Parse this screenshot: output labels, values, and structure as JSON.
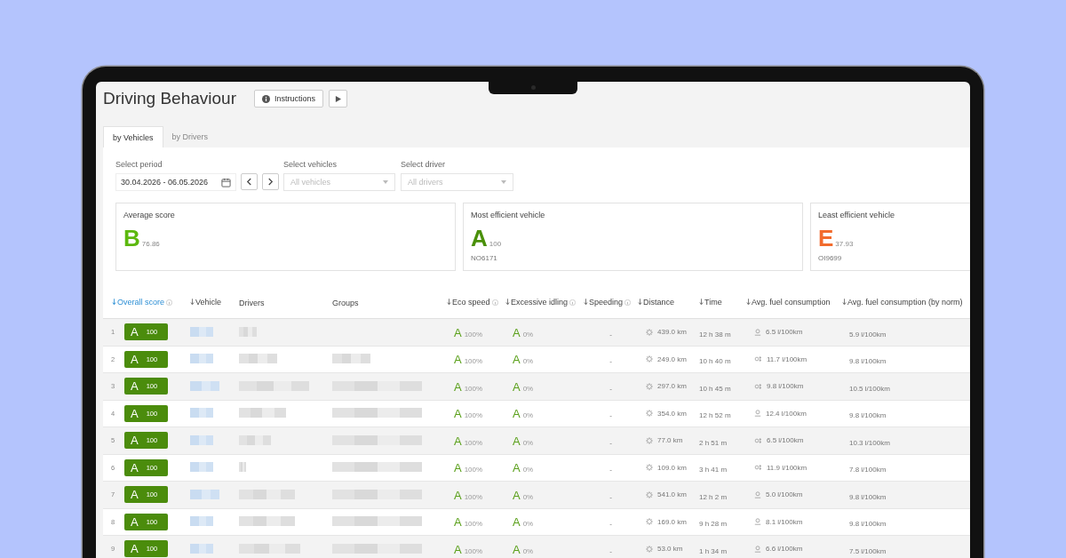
{
  "window": {
    "title": "Driving Behaviour"
  },
  "header_buttons": [
    {
      "kind": "info",
      "label": "Instructions"
    },
    {
      "kind": "play"
    }
  ],
  "tabs": [
    {
      "label": "by Vehicles",
      "selected": true
    },
    {
      "label": "by Drivers",
      "selected": false
    }
  ],
  "filters": {
    "period": {
      "label": "Select period",
      "value": "30.04.2026 - 06.05.2026"
    },
    "vehicles": {
      "label": "Select vehicles",
      "placeholder": "All vehicles"
    },
    "driver": {
      "label": "Select driver",
      "placeholder": "All drivers"
    }
  },
  "summary_cards": [
    {
      "title": "Average score",
      "grade": "B",
      "score": "76.86",
      "color": "#5cb80e"
    },
    {
      "title": "Most efficient vehicle",
      "grade": "A",
      "score": "100",
      "vehicle": "NO6171",
      "color": "#4a900a"
    },
    {
      "title": "Least efficient vehicle",
      "grade": "E",
      "score": "37.93",
      "vehicle": "OI9699",
      "color": "#f26b2d"
    }
  ],
  "table": {
    "columns": [
      {
        "label": "Overall score",
        "sortable": true,
        "sorted": true,
        "info": true
      },
      {
        "label": "Vehicle",
        "sortable": true,
        "sorted": false,
        "info": false
      },
      {
        "label": "Drivers",
        "sortable": false,
        "sorted": false,
        "info": false
      },
      {
        "label": "Groups",
        "sortable": false,
        "sorted": false,
        "info": false
      },
      {
        "label": "Eco speed",
        "sortable": true,
        "sorted": false,
        "info": true
      },
      {
        "label": "Excessive idling",
        "sortable": true,
        "sorted": false,
        "info": true
      },
      {
        "label": "Speeding",
        "sortable": true,
        "sorted": false,
        "info": true
      },
      {
        "label": "Distance",
        "sortable": true,
        "sorted": false,
        "info": false
      },
      {
        "label": "Time",
        "sortable": true,
        "sorted": false,
        "info": false
      },
      {
        "label": "Avg. fuel consumption",
        "sortable": true,
        "sorted": false,
        "info": false
      },
      {
        "label": "Avg. fuel consumption (by norm)",
        "sortable": true,
        "sorted": false,
        "info": false
      }
    ],
    "rows": [
      {
        "number": "1",
        "score_grade": "A",
        "score": "100",
        "eco_grade": "A",
        "eco": "100%",
        "idling_grade": "A",
        "idling": "0%",
        "speeding": "-",
        "distance": "439.0 km",
        "time": "12 h 38 m",
        "idle_icon": false,
        "fuel": "6.5 l/100km",
        "fuel_norm": "5.9 l/100km"
      },
      {
        "number": "2",
        "score_grade": "A",
        "score": "100",
        "eco_grade": "A",
        "eco": "100%",
        "idling_grade": "A",
        "idling": "0%",
        "speeding": "-",
        "distance": "249.0 km",
        "time": "10 h 40 m",
        "idle_icon": true,
        "fuel": "11.7 l/100km",
        "fuel_norm": "9.8 l/100km"
      },
      {
        "number": "3",
        "score_grade": "A",
        "score": "100",
        "eco_grade": "A",
        "eco": "100%",
        "idling_grade": "A",
        "idling": "0%",
        "speeding": "-",
        "distance": "297.0 km",
        "time": "10 h 45 m",
        "idle_icon": true,
        "fuel": "9.8 l/100km",
        "fuel_norm": "10.5 l/100km"
      },
      {
        "number": "4",
        "score_grade": "A",
        "score": "100",
        "eco_grade": "A",
        "eco": "100%",
        "idling_grade": "A",
        "idling": "0%",
        "speeding": "-",
        "distance": "354.0 km",
        "time": "12 h 52 m",
        "idle_icon": false,
        "fuel": "12.4 l/100km",
        "fuel_norm": "9.8 l/100km"
      },
      {
        "number": "5",
        "score_grade": "A",
        "score": "100",
        "eco_grade": "A",
        "eco": "100%",
        "idling_grade": "A",
        "idling": "0%",
        "speeding": "-",
        "distance": "77.0 km",
        "time": "2 h 51 m",
        "idle_icon": true,
        "fuel": "6.5 l/100km",
        "fuel_norm": "10.3 l/100km"
      },
      {
        "number": "6",
        "score_grade": "A",
        "score": "100",
        "eco_grade": "A",
        "eco": "100%",
        "idling_grade": "A",
        "idling": "0%",
        "speeding": "-",
        "distance": "109.0 km",
        "time": "3 h 41 m",
        "idle_icon": true,
        "fuel": "11.9 l/100km",
        "fuel_norm": "7.8 l/100km"
      },
      {
        "number": "7",
        "score_grade": "A",
        "score": "100",
        "eco_grade": "A",
        "eco": "100%",
        "idling_grade": "A",
        "idling": "0%",
        "speeding": "-",
        "distance": "541.0 km",
        "time": "12 h 2 m",
        "idle_icon": false,
        "fuel": "5.0 l/100km",
        "fuel_norm": "9.8 l/100km"
      },
      {
        "number": "8",
        "score_grade": "A",
        "score": "100",
        "eco_grade": "A",
        "eco": "100%",
        "idling_grade": "A",
        "idling": "0%",
        "speeding": "-",
        "distance": "169.0 km",
        "time": "9 h 28 m",
        "idle_icon": false,
        "fuel": "8.1 l/100km",
        "fuel_norm": "9.8 l/100km"
      },
      {
        "number": "9",
        "score_grade": "A",
        "score": "100",
        "eco_grade": "A",
        "eco": "100%",
        "idling_grade": "A",
        "idling": "0%",
        "speeding": "-",
        "distance": "53.0 km",
        "time": "1 h 34 m",
        "idle_icon": false,
        "fuel": "6.6 l/100km",
        "fuel_norm": "7.5 l/100km"
      }
    ]
  }
}
